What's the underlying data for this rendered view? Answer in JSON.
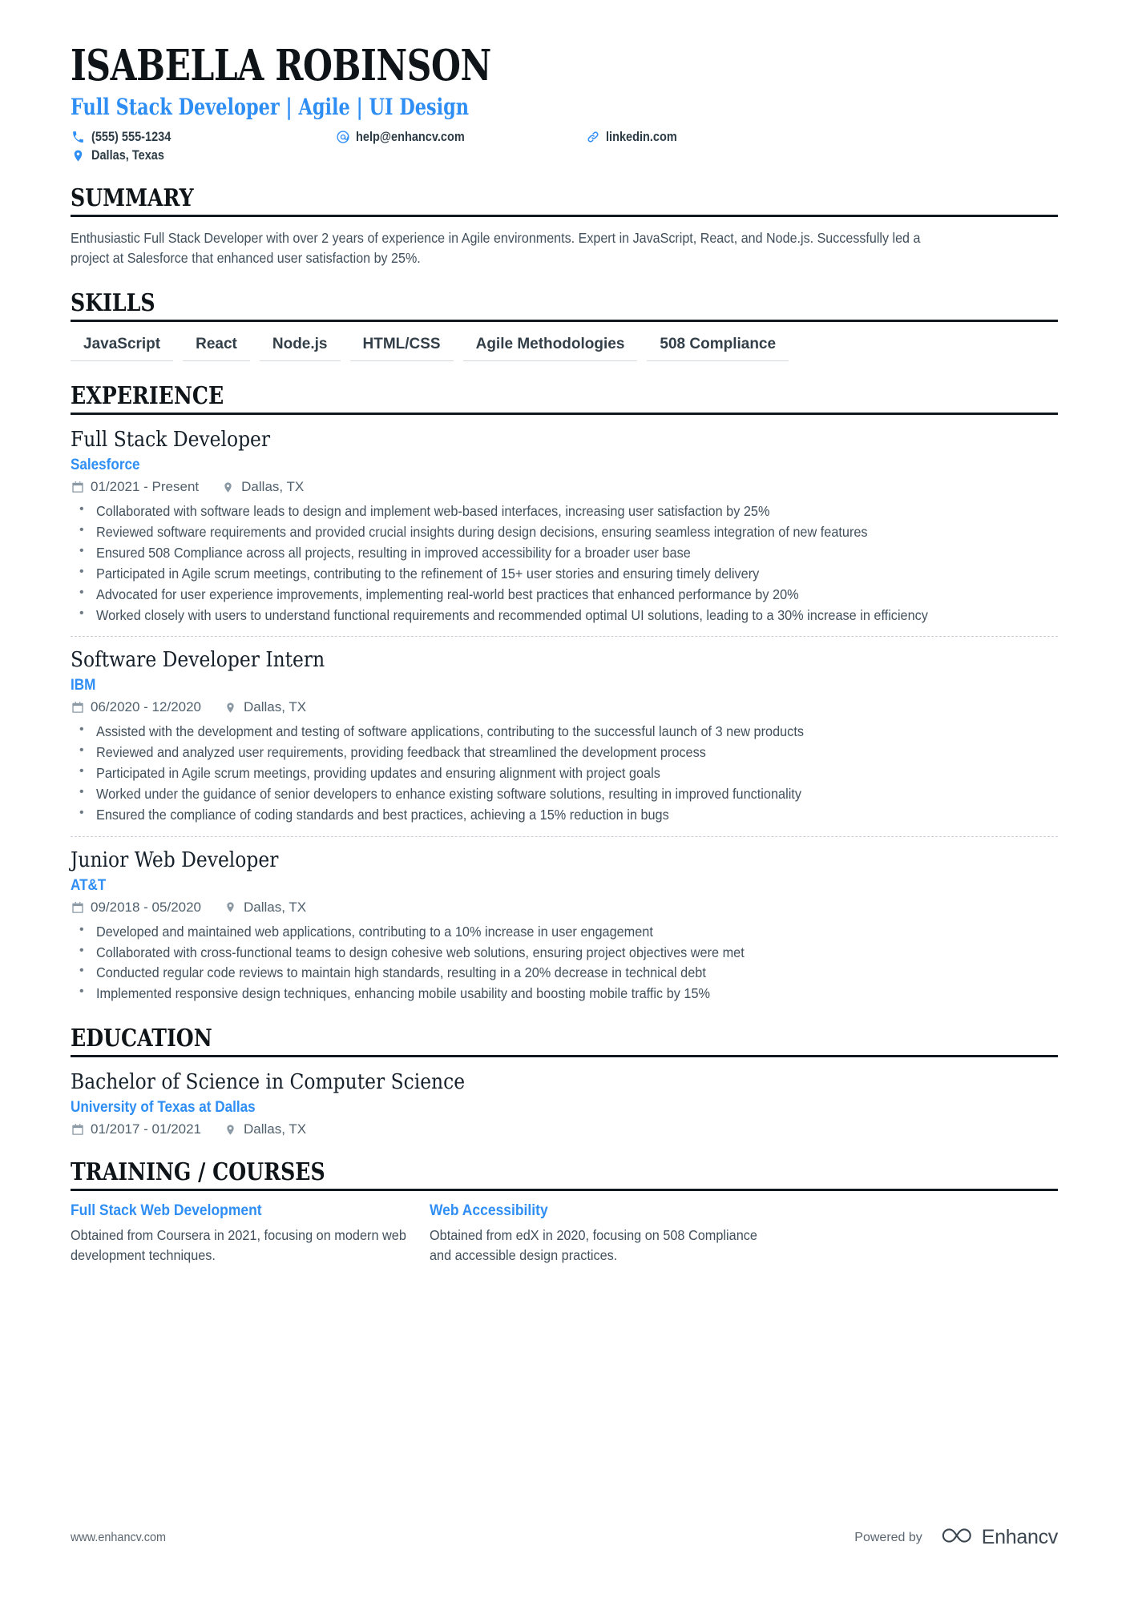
{
  "header": {
    "name": "ISABELLA ROBINSON",
    "headline": "Full Stack Developer | Agile | UI Design",
    "contacts": [
      {
        "icon": "phone-icon",
        "value": "(555) 555-1234"
      },
      {
        "icon": "email-icon",
        "value": "help@enhancv.com"
      },
      {
        "icon": "link-icon",
        "value": "linkedin.com"
      },
      {
        "icon": "location-pin-icon",
        "value": "Dallas, Texas"
      }
    ]
  },
  "sections": {
    "summary": {
      "title": "SUMMARY",
      "text": "Enthusiastic Full Stack Developer with over 2 years of experience in Agile environments. Expert in JavaScript, React, and Node.js. Successfully led a project at Salesforce that enhanced user satisfaction by 25%."
    },
    "skills": {
      "title": "SKILLS",
      "items": [
        "JavaScript",
        "React",
        "Node.js",
        "HTML/CSS",
        "Agile Methodologies",
        "508 Compliance"
      ]
    },
    "experience": {
      "title": "EXPERIENCE",
      "entries": [
        {
          "job_title": "Full Stack Developer",
          "company": "Salesforce",
          "dates": "01/2021 - Present",
          "location": "Dallas, TX",
          "bullets": [
            "Collaborated with software leads to design and implement web-based interfaces, increasing user satisfaction by 25%",
            "Reviewed software requirements and provided crucial insights during design decisions, ensuring seamless integration of new features",
            "Ensured 508 Compliance across all projects, resulting in improved accessibility for a broader user base",
            "Participated in Agile scrum meetings, contributing to the refinement of 15+ user stories and ensuring timely delivery",
            "Advocated for user experience improvements, implementing real-world best practices that enhanced performance by 20%",
            "Worked closely with users to understand functional requirements and recommended optimal UI solutions, leading to a 30% increase in efficiency"
          ]
        },
        {
          "job_title": "Software Developer Intern",
          "company": "IBM",
          "dates": "06/2020 - 12/2020",
          "location": "Dallas, TX",
          "bullets": [
            "Assisted with the development and testing of software applications, contributing to the successful launch of 3 new products",
            "Reviewed and analyzed user requirements, providing feedback that streamlined the development process",
            "Participated in Agile scrum meetings, providing updates and ensuring alignment with project goals",
            "Worked under the guidance of senior developers to enhance existing software solutions, resulting in improved functionality",
            "Ensured the compliance of coding standards and best practices, achieving a 15% reduction in bugs"
          ]
        },
        {
          "job_title": "Junior Web Developer",
          "company": "AT&T",
          "dates": "09/2018 - 05/2020",
          "location": "Dallas, TX",
          "bullets": [
            "Developed and maintained web applications, contributing to a 10% increase in user engagement",
            "Collaborated with cross-functional teams to design cohesive web solutions, ensuring project objectives were met",
            "Conducted regular code reviews to maintain high standards, resulting in a 20% decrease in technical debt",
            "Implemented responsive design techniques, enhancing mobile usability and boosting mobile traffic by 15%"
          ]
        }
      ]
    },
    "education": {
      "title": "EDUCATION",
      "entries": [
        {
          "degree": "Bachelor of Science in Computer Science",
          "school": "University of Texas at Dallas",
          "dates": "01/2017 - 01/2021",
          "location": "Dallas, TX"
        }
      ]
    },
    "training": {
      "title": "TRAINING / COURSES",
      "courses": [
        {
          "title": "Full Stack Web Development",
          "description": "Obtained from Coursera in 2021, focusing on modern web development techniques."
        },
        {
          "title": "Web Accessibility",
          "description": "Obtained from edX in 2020, focusing on 508 Compliance and accessible design practices."
        }
      ]
    }
  },
  "footer": {
    "url": "www.enhancv.com",
    "powered_by": "Powered by",
    "brand": "Enhancv"
  },
  "colors": {
    "accent": "#2f8ef4",
    "heading": "#0f1419",
    "body": "#41505c",
    "rule": "#111820",
    "chip_underline": "#d4d9dd"
  }
}
